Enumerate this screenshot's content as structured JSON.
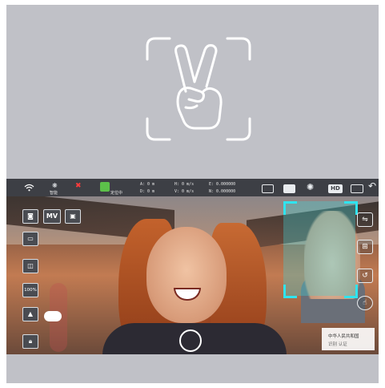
{
  "hero": {
    "icon": "peace-sign-gesture-icon"
  },
  "status_bar": {
    "wifi_icon": "wifi-icon",
    "logo_caption": "智能",
    "badge_caption": "定位中",
    "a_value": "A: 0 m",
    "d_value": "D: 0 m",
    "h_speed": "H: 0 m/s",
    "v_speed": "V: 0 m/s",
    "e_coord": "E: 0.000000",
    "n_coord": "N: 0.000000",
    "hd_label": "HD"
  },
  "left_controls": {
    "photo_icon": "camera-icon",
    "mv_label": "MV",
    "video_icon": "video-icon",
    "track_icon": "record-icon",
    "split_icon": "split-screen-icon",
    "percent_label": "100%",
    "nav_icon": "navigate-icon",
    "lock_icon": "lock-icon"
  },
  "right_controls": {
    "flip_icon": "flip-icon",
    "grid_icon": "grid-icon",
    "return_icon": "return-icon",
    "gesture_icon": "gesture-icon"
  },
  "watermark": {
    "line1": "中华人民共和国",
    "line2": "识别 认证"
  },
  "colors": {
    "card_bg": "#c0c1c7",
    "statusbar_bg": "#3d3f45",
    "detect_box": "#2fe4ef"
  }
}
